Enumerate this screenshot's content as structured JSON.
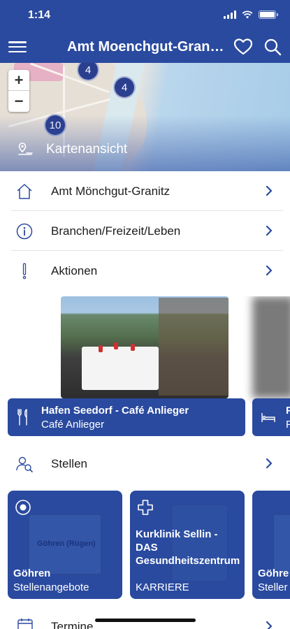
{
  "status_bar": {
    "time": "1:14"
  },
  "nav": {
    "title": "Amt Moenchgut-Granitz"
  },
  "map": {
    "zoom_in": "+",
    "zoom_out": "−",
    "clusters": [
      "4",
      "4",
      "10"
    ],
    "label": "Kartenansicht"
  },
  "menu": [
    {
      "label": "Amt Mönchgut-Granitz",
      "icon": "home-icon"
    },
    {
      "label": "Branchen/Freizeit/Leben",
      "icon": "info-icon"
    },
    {
      "label": "Aktionen",
      "icon": "exclamation-icon"
    }
  ],
  "carousel": {
    "card1": {
      "title": "Hafen Seedorf - Café Anlieger",
      "subtitle": "Café Anlieger",
      "icon": "fork-knife-icon"
    },
    "card2": {
      "title": "P",
      "subtitle": "P",
      "icon": "bed-icon"
    }
  },
  "stellen": {
    "label": "Stellen",
    "icon": "people-search-icon"
  },
  "jobs": [
    {
      "image_text": "Göhren (Rügen)",
      "title": "Göhren",
      "subtitle": "Stellenangebote",
      "icon": "target-icon"
    },
    {
      "image_text": "",
      "title": "Kurklinik Sellin - DAS Gesundheitszentrum",
      "subtitle": "KARRIERE",
      "icon": "medical-cross-icon"
    },
    {
      "image_text": "",
      "title": "Göhre",
      "subtitle": "Steller",
      "icon": ""
    }
  ],
  "termine": {
    "label": "Termine",
    "icon": "calendar-icon"
  },
  "colors": {
    "primary": "#2a4a9f",
    "accent": "#2b3f8f",
    "chevron": "#2a4a9f"
  }
}
